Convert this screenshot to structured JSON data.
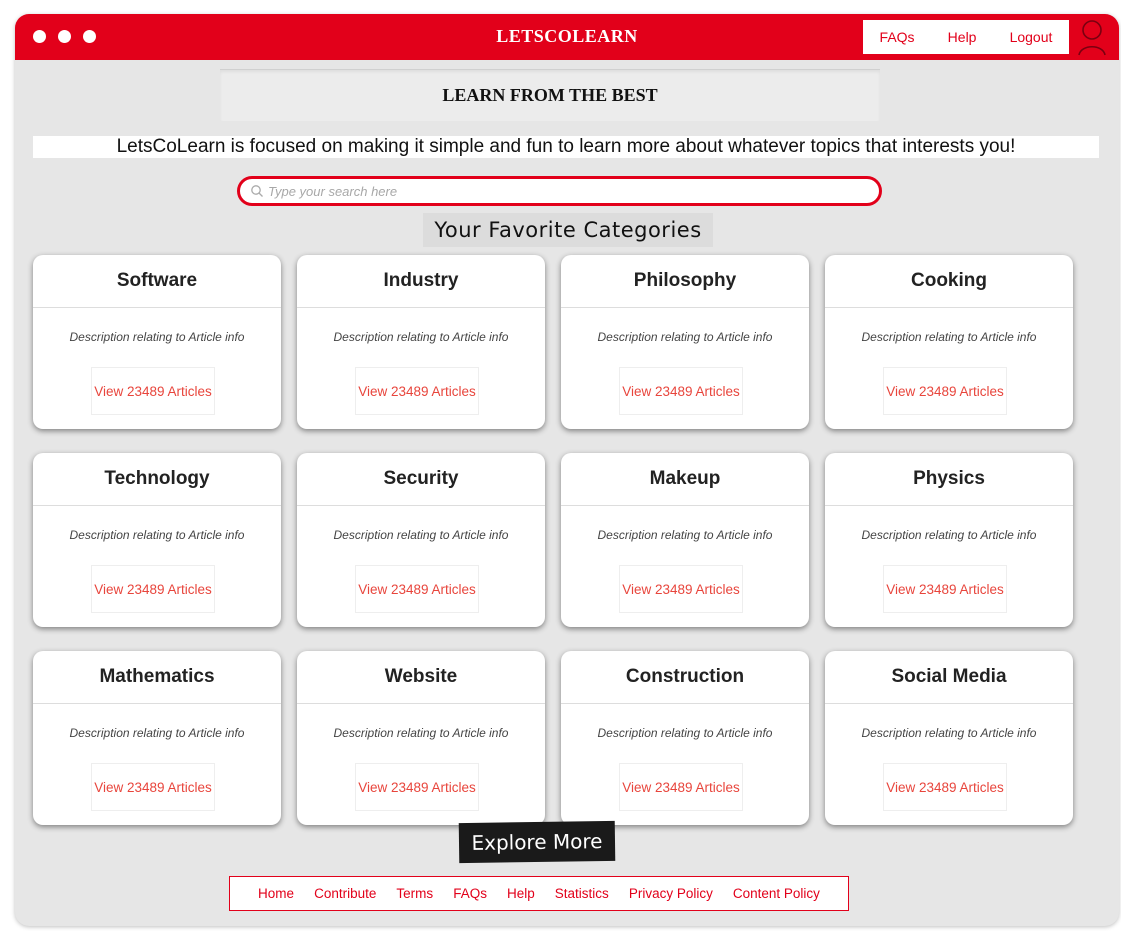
{
  "app": {
    "title": "LETSCOLEARN"
  },
  "nav": {
    "items": [
      "FAQs",
      "Help",
      "Logout"
    ]
  },
  "hero": {
    "heading": "LEARN FROM THE BEST"
  },
  "tagline": "LetsCoLearn is focused on making it simple and fun to learn more about whatever topics that interests you!",
  "search": {
    "placeholder": "Type your search here"
  },
  "categories": {
    "title": "Your Favorite Categories",
    "cards": [
      {
        "title": "Software",
        "description": "Description relating to Article info",
        "button": "View 23489 Articles"
      },
      {
        "title": "Industry",
        "description": "Description relating to Article info",
        "button": "View 23489 Articles"
      },
      {
        "title": "Philosophy",
        "description": "Description relating to Article info",
        "button": "View 23489 Articles"
      },
      {
        "title": "Cooking",
        "description": "Description relating to Article info",
        "button": "View 23489 Articles"
      },
      {
        "title": "Technology",
        "description": "Description relating to Article info",
        "button": "View 23489 Articles"
      },
      {
        "title": "Security",
        "description": "Description relating to Article info",
        "button": "View 23489 Articles"
      },
      {
        "title": "Makeup",
        "description": "Description relating to Article info",
        "button": "View 23489 Articles"
      },
      {
        "title": "Physics",
        "description": "Description relating to Article info",
        "button": "View 23489 Articles"
      },
      {
        "title": "Mathematics",
        "description": "Description relating to Article info",
        "button": "View 23489 Articles"
      },
      {
        "title": "Website",
        "description": "Description relating to Article info",
        "button": "View 23489 Articles"
      },
      {
        "title": "Construction",
        "description": "Description relating to Article info",
        "button": "View 23489 Articles"
      },
      {
        "title": "Social Media",
        "description": "Description relating to Article info",
        "button": "View 23489 Articles"
      }
    ]
  },
  "explore": {
    "label": "Explore More"
  },
  "footer": {
    "links": [
      "Home",
      "Contribute",
      "Terms",
      "FAQs",
      "Help",
      "Statistics",
      "Privacy Policy",
      "Content Policy"
    ]
  },
  "colors": {
    "brand": "#e2001a",
    "link": "#e8453c",
    "background": "#e6e6e6"
  },
  "icons": {
    "window_dots": "window-control-dots",
    "search": "search-icon",
    "user": "user-avatar-icon"
  }
}
